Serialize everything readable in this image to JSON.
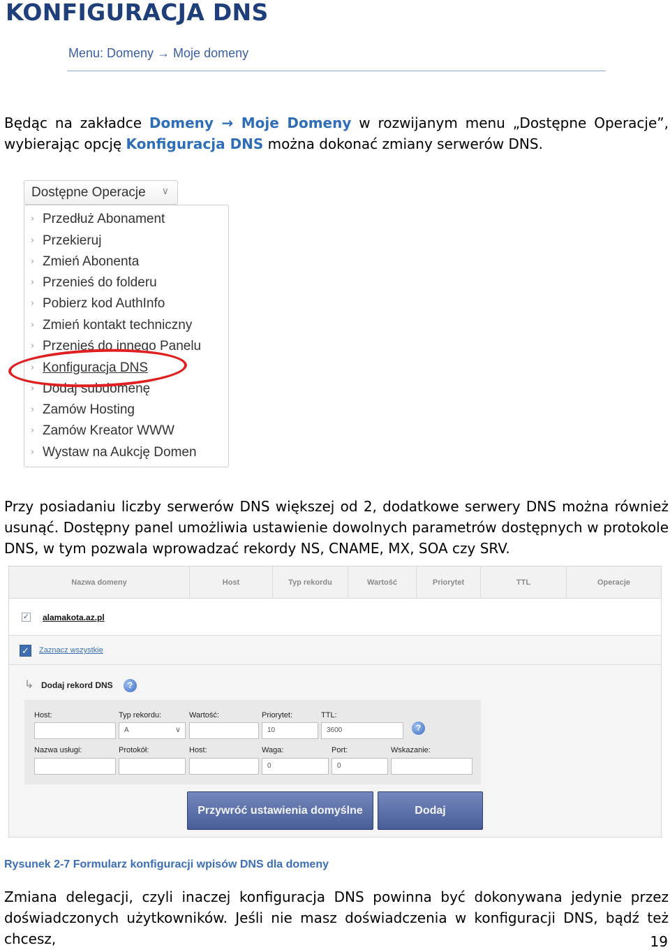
{
  "title": "KONFIGURACJA DNS",
  "subtitle": "Menu: Domeny → Moje domeny",
  "para1": {
    "line1": {
      "t1": "Będąc na zakładce ",
      "link1": "Domeny",
      "arrow": " → ",
      "link2": "Moje Domeny",
      "t2": " w rozwijanym menu „Dostępne Operacje”,"
    },
    "line2": {
      "t1": "wybierając opcję ",
      "link": "Konfiguracja DNS",
      "t2": " można dokonać zmiany serwerów DNS."
    }
  },
  "dropdown": {
    "header": "Dostępne Operacje",
    "items": [
      "Przedłuż Abonament",
      "Przekieruj",
      "Zmień Abonenta",
      "Przenieś do folderu",
      "Pobierz kod AuthInfo",
      "Zmień kontakt techniczny",
      "Przenieś do innego Panelu",
      "Konfiguracja DNS",
      "Dodaj subdomenę",
      "Zamów Hosting",
      "Zamów Kreator WWW",
      "Wystaw na Aukcję Domen"
    ]
  },
  "para2": {
    "line1": "Przy posiadaniu liczby serwerów DNS większej od 2, dodatkowe serwery DNS można również",
    "line2": "usunąć. Dostępny panel umożliwia ustawienie dowolnych parametrów dostępnych w protokole",
    "line3": "DNS, w tym pozwala wprowadzać rekordy NS, CNAME, MX, SOA czy SRV."
  },
  "panel": {
    "columns": [
      "Nazwa domeny",
      "Host",
      "Typ rekordu",
      "Wartość",
      "Priorytet",
      "TTL",
      "Operacje"
    ],
    "domain": "alamakota.az.pl",
    "select_all": "Zaznacz wszystkie",
    "add_record": "Dodaj rekord DNS",
    "form": {
      "host_label": "Host:",
      "type_label": "Typ rekordu:",
      "type_value": "A",
      "value_label": "Wartość:",
      "priority_label": "Priorytet:",
      "priority_value": "10",
      "ttl_label": "TTL:",
      "ttl_value": "3600",
      "service_label": "Nazwa usługi:",
      "protocol_label": "Protokół:",
      "host2_label": "Host:",
      "weight_label": "Waga:",
      "weight_value": "0",
      "port_label": "Port:",
      "port_value": "0",
      "target_label": "Wskazanie:"
    },
    "restore_button": "Przywróć ustawienia domyślne",
    "add_button": "Dodaj"
  },
  "caption": "Rysunek 2-7 Formularz konfiguracji wpisów DNS dla domeny",
  "para3": {
    "line1": "Zmiana delegacji, czyli inaczej konfiguracja DNS powinna być dokonywana jedynie przez",
    "line2": "doświadczonych użytkowników. Jeśli nie masz doświadczenia w konfiguracji DNS, bądź też chcesz,"
  },
  "page_number": "19",
  "colors": {
    "heading": "#1f3f7a",
    "link": "#2e6db7",
    "highlight_ring": "#e02020",
    "button": "#485d97"
  }
}
